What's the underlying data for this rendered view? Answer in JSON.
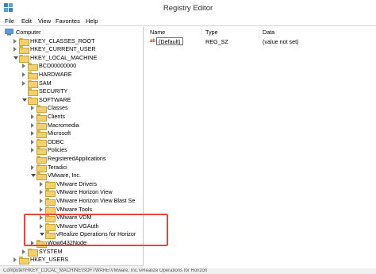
{
  "window": {
    "title": "Registry Editor"
  },
  "menu": [
    "File",
    "Edit",
    "View",
    "Favorites",
    "Help"
  ],
  "tree": [
    {
      "label": "Computer",
      "depth": 0,
      "state": "open",
      "icon": "computer-icon"
    },
    {
      "label": "HKEY_CLASSES_ROOT",
      "depth": 1,
      "state": "closed"
    },
    {
      "label": "HKEY_CURRENT_USER",
      "depth": 1,
      "state": "closed"
    },
    {
      "label": "HKEY_LOCAL_MACHINE",
      "depth": 1,
      "state": "open"
    },
    {
      "label": "BCD00000000",
      "depth": 2,
      "state": "closed"
    },
    {
      "label": "HARDWARE",
      "depth": 2,
      "state": "closed"
    },
    {
      "label": "SAM",
      "depth": 2,
      "state": "closed"
    },
    {
      "label": "SECURITY",
      "depth": 2,
      "state": "none"
    },
    {
      "label": "SOFTWARE",
      "depth": 2,
      "state": "open"
    },
    {
      "label": "Classes",
      "depth": 3,
      "state": "closed"
    },
    {
      "label": "Clients",
      "depth": 3,
      "state": "closed"
    },
    {
      "label": "Macromedia",
      "depth": 3,
      "state": "closed"
    },
    {
      "label": "Microsoft",
      "depth": 3,
      "state": "closed"
    },
    {
      "label": "ODBC",
      "depth": 3,
      "state": "closed"
    },
    {
      "label": "Policies",
      "depth": 3,
      "state": "closed"
    },
    {
      "label": "RegisteredApplications",
      "depth": 3,
      "state": "none"
    },
    {
      "label": "Teradici",
      "depth": 3,
      "state": "closed"
    },
    {
      "label": "VMware, Inc.",
      "depth": 3,
      "state": "open"
    },
    {
      "label": "VMware Drivers",
      "depth": 4,
      "state": "closed"
    },
    {
      "label": "VMware Horizon View",
      "depth": 4,
      "state": "closed"
    },
    {
      "label": "VMware Horizon View Blast Se",
      "depth": 4,
      "state": "closed"
    },
    {
      "label": "VMware Tools",
      "depth": 4,
      "state": "closed"
    },
    {
      "label": "VMware VDM",
      "depth": 4,
      "state": "closed"
    },
    {
      "label": "VMware VGAuth",
      "depth": 4,
      "state": "closed"
    },
    {
      "label": "vRealize Operations for Horizor",
      "depth": 4,
      "state": "open"
    },
    {
      "label": "Wow6432Node",
      "depth": 3,
      "state": "closed"
    },
    {
      "label": "SYSTEM",
      "depth": 2,
      "state": "closed"
    },
    {
      "label": "HKEY_USERS",
      "depth": 1,
      "state": "closed"
    }
  ],
  "list": {
    "columns": [
      "Name",
      "Type",
      "Data"
    ],
    "rows": [
      {
        "icon": "ab",
        "name": "(Default)",
        "type": "REG_SZ",
        "data": "(value not set)"
      }
    ]
  },
  "status": "Computer\\HKEY_LOCAL_MACHINE\\SOFTWARE\\VMware, Inc.\\vRealize Operations for Horizon",
  "colors": {
    "highlight": "#e8463b",
    "folder": "#f2d06b"
  }
}
